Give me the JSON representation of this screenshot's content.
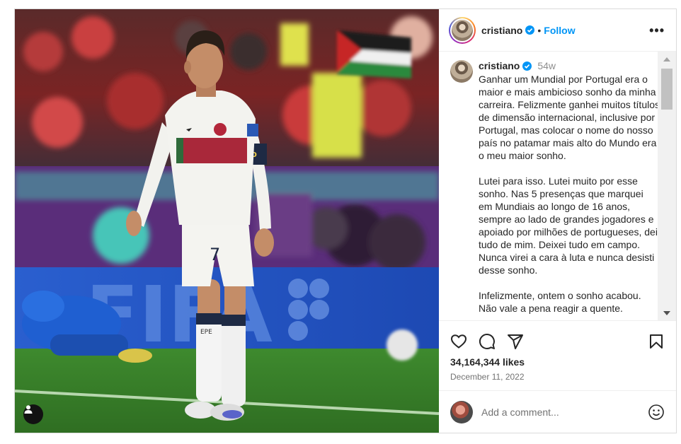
{
  "post": {
    "username": "cristiano",
    "follow_label": "Follow",
    "separator": "•",
    "more_label": "•••",
    "caption_time": "54w",
    "caption_text": "Ganhar um Mundial por Portugal era o maior e mais ambicioso sonho da minha carreira. Felizmente ganhei muitos títulos de dimensão internacional, inclusive por Portugal, mas colocar o nome do nosso país no patamar mais alto do Mundo era o meu maior sonho.\n\nLutei para isso. Lutei muito por esse sonho. Nas 5 presenças que marquei em Mundiais ao longo de 16 anos, sempre ao lado de grandes jogadores e apoiado por milhões de portugueses, dei tudo de mim. Deixei tudo em campo. Nunca virei a cara à luta e nunca desisti desse sonho.\n\nInfelizmente, ontem o sonho acabou.\nNão vale a pena reagir a quente.",
    "likes": "34,164,344 likes",
    "date": "December 11, 2022",
    "comment_placeholder": "Add a comment...",
    "photo": {
      "banner_text": "FIFA",
      "shorts_number": "7",
      "sock_text": "EPE",
      "armband_text": "NO"
    }
  },
  "icons": {
    "verified": "verified-badge-icon",
    "like": "heart-icon",
    "comment": "comment-icon",
    "share": "share-icon",
    "save": "bookmark-icon",
    "emoji": "emoji-icon",
    "tagged": "user-tag-icon"
  },
  "colors": {
    "accent": "#0095f6",
    "text": "#262626",
    "muted": "#737373",
    "border": "#dbdbdb"
  }
}
